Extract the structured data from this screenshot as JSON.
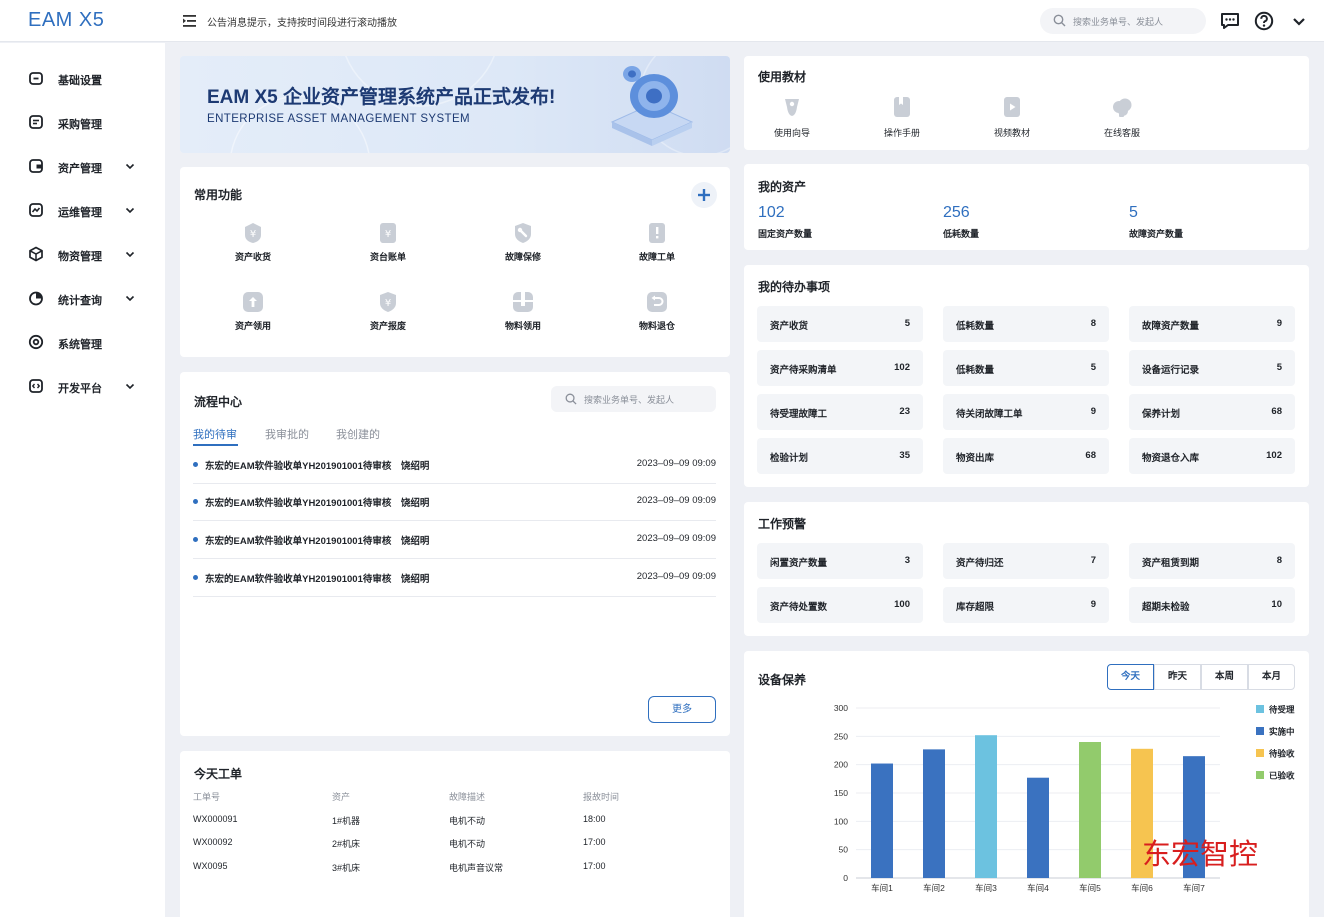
{
  "app": {
    "logo": "EAM X5"
  },
  "header": {
    "notice": "公告消息提示，支持按时间段进行滚动播放",
    "search_placeholder": "搜索业务单号、发起人"
  },
  "sidebar": {
    "items": [
      {
        "label": "基础设置",
        "expandable": false
      },
      {
        "label": "采购管理",
        "expandable": false
      },
      {
        "label": "资产管理",
        "expandable": true
      },
      {
        "label": "运维管理",
        "expandable": true
      },
      {
        "label": "物资管理",
        "expandable": true
      },
      {
        "label": "统计查询",
        "expandable": true
      },
      {
        "label": "系统管理",
        "expandable": false
      },
      {
        "label": "开发平台",
        "expandable": true
      }
    ]
  },
  "banner": {
    "title": "EAM X5 企业资产管理系统产品正式发布!",
    "subtitle": "ENTERPRISE ASSET MANAGEMENT SYSTEM"
  },
  "common": {
    "title": "常用功能",
    "items": [
      {
        "label": "资产收货",
        "icon": "yen-badge-icon"
      },
      {
        "label": "资台账单",
        "icon": "yen-doc-icon"
      },
      {
        "label": "故障保修",
        "icon": "wrench-shield-icon"
      },
      {
        "label": "故障工单",
        "icon": "alert-doc-icon"
      },
      {
        "label": "资产领用",
        "icon": "upload-icon"
      },
      {
        "label": "资产报废",
        "icon": "yen-shield-icon"
      },
      {
        "label": "物料领用",
        "icon": "box-icon"
      },
      {
        "label": "物料退仓",
        "icon": "return-icon"
      }
    ]
  },
  "process": {
    "title": "流程中心",
    "search_placeholder": "搜索业务单号、发起人",
    "tabs": [
      "我的待审",
      "我审批的",
      "我创建的"
    ],
    "rows": [
      {
        "title": "东宏的EAM软件验收单YH201901001待审核",
        "user": "饶绍明",
        "time": "2023–09–09 09:09"
      },
      {
        "title": "东宏的EAM软件验收单YH201901001待审核",
        "user": "饶绍明",
        "time": "2023–09–09 09:09"
      },
      {
        "title": "东宏的EAM软件验收单YH201901001待审核",
        "user": "饶绍明",
        "time": "2023–09–09 09:09"
      },
      {
        "title": "东宏的EAM软件验收单YH201901001待审核",
        "user": "饶绍明",
        "time": "2023–09–09 09:09"
      }
    ],
    "more": "更多"
  },
  "today_orders": {
    "title": "今天工单",
    "headers": [
      "工单号",
      "资产",
      "故障描述",
      "报故时间"
    ],
    "rows": [
      [
        "WX000091",
        "1#机器",
        "电机不动",
        "18:00"
      ],
      [
        "WX00092",
        "2#机床",
        "电机不动",
        "17:00"
      ],
      [
        "WX0095",
        "3#机床",
        "电机声音议常",
        "17:00"
      ]
    ]
  },
  "tutorials": {
    "title": "使用教材",
    "items": [
      {
        "label": "使用向导",
        "icon": "guide-icon"
      },
      {
        "label": "操作手册",
        "icon": "manual-icon"
      },
      {
        "label": "视频教材",
        "icon": "video-icon"
      },
      {
        "label": "在线客服",
        "icon": "cloud-service-icon"
      }
    ]
  },
  "my_assets": {
    "title": "我的资产",
    "items": [
      {
        "value": "102",
        "label": "固定资产数量"
      },
      {
        "value": "256",
        "label": "低耗数量"
      },
      {
        "value": "5",
        "label": "故障资产数量"
      }
    ]
  },
  "todo": {
    "title": "我的待办事项",
    "items": [
      {
        "label": "资产收货",
        "value": "5"
      },
      {
        "label": "低耗数量",
        "value": "8"
      },
      {
        "label": "故障资产数量",
        "value": "9"
      },
      {
        "label": "资产待采购清单",
        "value": "102"
      },
      {
        "label": "低耗数量",
        "value": "5"
      },
      {
        "label": "设备运行记录",
        "value": "5"
      },
      {
        "label": "待受理故障工",
        "value": "23"
      },
      {
        "label": "待关闭故障工单",
        "value": "9"
      },
      {
        "label": "保养计划",
        "value": "68"
      },
      {
        "label": "检验计划",
        "value": "35"
      },
      {
        "label": "物资出库",
        "value": "68"
      },
      {
        "label": "物资退仓入库",
        "value": "102"
      }
    ]
  },
  "warning": {
    "title": "工作预警",
    "items": [
      {
        "label": "闲置资产数量",
        "value": "3"
      },
      {
        "label": "资产待归还",
        "value": "7"
      },
      {
        "label": "资产租赁到期",
        "value": "8"
      },
      {
        "label": "资产待处置数",
        "value": "100"
      },
      {
        "label": "库存超限",
        "value": "9"
      },
      {
        "label": "超期未检验",
        "value": "10"
      }
    ]
  },
  "maintenance": {
    "title": "设备保养",
    "ranges": [
      "今天",
      "昨天",
      "本周",
      "本月"
    ],
    "active_range": "今天"
  },
  "chart_data": {
    "type": "bar",
    "categories": [
      "车间1",
      "车间2",
      "车间3",
      "车间4",
      "车间5",
      "车间6",
      "车间7"
    ],
    "values": [
      202,
      227,
      252,
      177,
      240,
      228,
      215
    ],
    "bar_series": [
      "实施中",
      "实施中",
      "待受理",
      "实施中",
      "已验收",
      "待验收",
      "实施中"
    ],
    "legend": [
      {
        "name": "待受理",
        "color": "#6cc2e0"
      },
      {
        "name": "实施中",
        "color": "#3a72c0"
      },
      {
        "name": "待验收",
        "color": "#f6c450"
      },
      {
        "name": "已验收",
        "color": "#92cb6c"
      }
    ],
    "yticks": [
      0,
      50,
      100,
      150,
      200,
      250,
      300
    ],
    "ylim": [
      0,
      300
    ],
    "legend_position": "right",
    "grid": true
  },
  "watermark": "东宏智控"
}
